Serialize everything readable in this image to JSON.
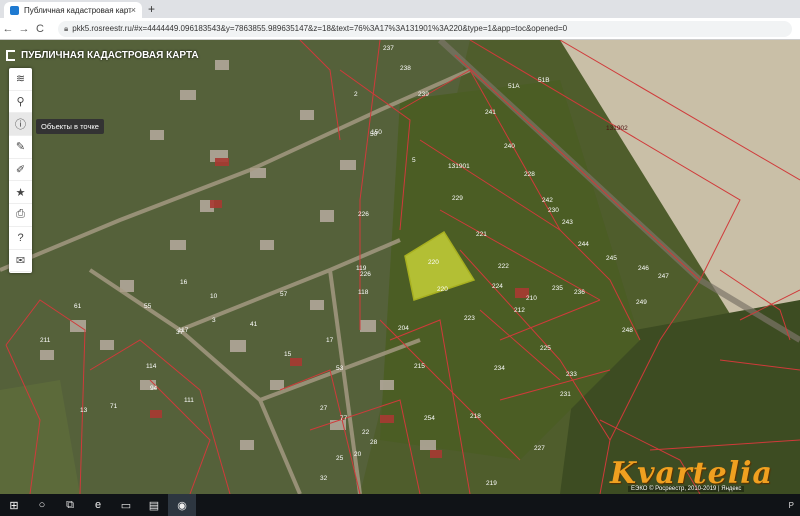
{
  "browser": {
    "tab_title": "Публичная кадастровая карта",
    "tab_close": "×",
    "new_tab": "+",
    "url": "pkk5.rosreestr.ru/#x=4444449.096183543&y=7863855.989635147&z=18&text=76%3A17%3A131901%3A220&type=1&app=toc&opened=0",
    "nav_back": "←",
    "nav_forward": "→",
    "nav_reload": "C"
  },
  "app": {
    "title": "ПУБЛИЧНАЯ КАДАСТРОВАЯ КАРТА",
    "tooltip": "Объекты в точке",
    "tools": [
      {
        "name": "layers-icon",
        "glyph": "≋"
      },
      {
        "name": "search-icon",
        "glyph": "⚲"
      },
      {
        "name": "info-icon",
        "glyph": "ⓘ"
      },
      {
        "name": "pencil-icon",
        "glyph": "✎"
      },
      {
        "name": "measure-icon",
        "glyph": "✐"
      },
      {
        "name": "star-icon",
        "glyph": "★"
      },
      {
        "name": "print-icon",
        "glyph": "⎙"
      },
      {
        "name": "help-icon",
        "glyph": "?"
      },
      {
        "name": "mail-icon",
        "glyph": "✉"
      }
    ]
  },
  "map": {
    "quarter_labels": [
      "131901",
      "131902"
    ],
    "selected_parcel_labels": [
      "220",
      "220"
    ],
    "parcel_labels": [
      "237",
      "238",
      "239",
      "241",
      "240",
      "228",
      "242",
      "243",
      "244",
      "245",
      "246",
      "247",
      "248",
      "221",
      "222",
      "224",
      "225",
      "223",
      "229",
      "230",
      "226",
      "249",
      "204",
      "215",
      "150",
      "233",
      "218",
      "219",
      "227",
      "231",
      "234",
      "235",
      "236",
      "210",
      "212",
      "211",
      "114",
      "117",
      "119",
      "118",
      "13",
      "61",
      "55",
      "37",
      "41",
      "57",
      "53",
      "94",
      "111",
      "71",
      "16",
      "10",
      "3",
      "5",
      "2",
      "15",
      "17",
      "50",
      "27",
      "77",
      "22",
      "28",
      "20",
      "25",
      "254",
      "226",
      "32"
    ],
    "road_labels": [
      "51A",
      "51B"
    ],
    "watermark": "Kvartelia",
    "attribution": "ЕЭКО © Росреестр, 2010-2019 | Яндекс"
  },
  "taskbar": {
    "items": [
      {
        "name": "windows-start-icon",
        "glyph": "⊞"
      },
      {
        "name": "search-taskbar-icon",
        "glyph": "○"
      },
      {
        "name": "task-view-icon",
        "glyph": "⧉"
      },
      {
        "name": "edge-browser-icon",
        "glyph": "e"
      },
      {
        "name": "file-explorer-icon",
        "glyph": "▭"
      },
      {
        "name": "store-icon",
        "glyph": "▤"
      },
      {
        "name": "chrome-icon",
        "glyph": "◉"
      }
    ],
    "tray": "Р"
  },
  "colors": {
    "parcel_border": "#d03a3a",
    "selected_fill": "#d6e03a",
    "field": "#c9bfa7"
  }
}
